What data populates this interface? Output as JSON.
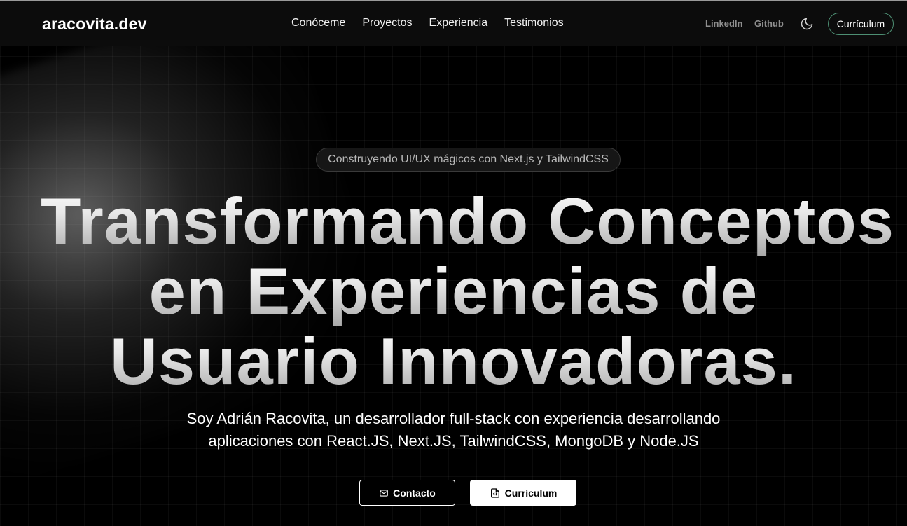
{
  "header": {
    "brand": "aracovita.dev",
    "nav": [
      {
        "label": "Conóceme"
      },
      {
        "label": "Proyectos"
      },
      {
        "label": "Experiencia"
      },
      {
        "label": "Testimonios"
      }
    ],
    "social": {
      "linkedin": "LinkedIn",
      "github": "Github"
    },
    "theme_icon": "moon-icon",
    "cv_label": "Currículum"
  },
  "hero": {
    "badge": "Construyendo UI/UX mágicos con Next.js y TailwindCSS",
    "title_lines": [
      "Transformando Conceptos",
      "en Experiencias de",
      "Usuario Innovadoras."
    ],
    "subtitle_lines": [
      "Soy Adrián Racovita, un desarrollador full-stack con experiencia desarrollando",
      "aplicaciones con React.JS, Next.JS, TailwindCSS, MongoDB y Node.JS"
    ],
    "buttons": {
      "contact": {
        "label": "Contacto",
        "icon": "mail-icon"
      },
      "cv": {
        "label": "Currículum",
        "icon": "file-icon"
      }
    }
  },
  "colors": {
    "background": "#000000",
    "accent_border": "#4d8f73",
    "muted_text": "#8f8f8f"
  }
}
